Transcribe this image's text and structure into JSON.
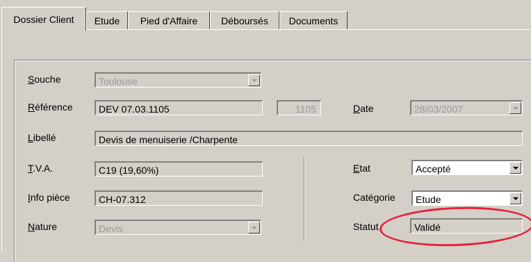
{
  "tabs": [
    {
      "label": "Dossier Client",
      "active": true
    },
    {
      "label": "Etude",
      "active": false
    },
    {
      "label": "Pied d'Affaire",
      "active": false
    },
    {
      "label": "Déboursés",
      "active": false
    },
    {
      "label": "Documents",
      "active": false
    }
  ],
  "form": {
    "souche": {
      "label_u": "S",
      "label_rest": "ouche",
      "value": "Toulouse"
    },
    "reference": {
      "label_u": "R",
      "label_rest": "éférence",
      "value": "DEV 07.03.1105",
      "number": "1105"
    },
    "date": {
      "label_u": "D",
      "label_rest": "ate",
      "value": "28/03/2007"
    },
    "libelle": {
      "label_u": "L",
      "label_rest": "ibellé",
      "value": "Devis de menuiserie /Charpente"
    },
    "tva": {
      "label_u": "T",
      "label_rest": ".V.A.",
      "value": "C19 (19,60%)"
    },
    "info_piece": {
      "label_u": "I",
      "label_rest": "nfo pièce",
      "value": "CH-07.312"
    },
    "nature": {
      "label_u": "N",
      "label_rest": "ature",
      "value": "Devis"
    },
    "etat": {
      "label_u": "E",
      "label_rest": "tat",
      "value": "Accepté"
    },
    "categorie": {
      "label_pre": "Caté",
      "label_u": "g",
      "label_rest": "orie",
      "value": "Etude"
    },
    "statut": {
      "label": "Statut",
      "value": "Validé"
    }
  },
  "colors": {
    "highlight_ellipse": "#e8203a",
    "window_bg": "#d4d0c8"
  }
}
